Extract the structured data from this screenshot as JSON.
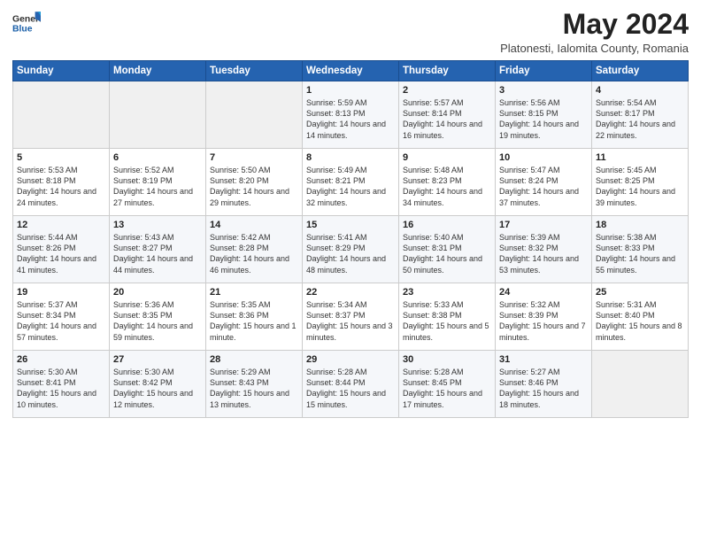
{
  "header": {
    "title": "May 2024",
    "subtitle": "Platonesti, Ialomita County, Romania"
  },
  "days_of_week": [
    "Sunday",
    "Monday",
    "Tuesday",
    "Wednesday",
    "Thursday",
    "Friday",
    "Saturday"
  ],
  "weeks": [
    [
      {
        "day": "",
        "info": ""
      },
      {
        "day": "",
        "info": ""
      },
      {
        "day": "",
        "info": ""
      },
      {
        "day": "1",
        "info": "Sunrise: 5:59 AM\nSunset: 8:13 PM\nDaylight: 14 hours\nand 14 minutes."
      },
      {
        "day": "2",
        "info": "Sunrise: 5:57 AM\nSunset: 8:14 PM\nDaylight: 14 hours\nand 16 minutes."
      },
      {
        "day": "3",
        "info": "Sunrise: 5:56 AM\nSunset: 8:15 PM\nDaylight: 14 hours\nand 19 minutes."
      },
      {
        "day": "4",
        "info": "Sunrise: 5:54 AM\nSunset: 8:17 PM\nDaylight: 14 hours\nand 22 minutes."
      }
    ],
    [
      {
        "day": "5",
        "info": "Sunrise: 5:53 AM\nSunset: 8:18 PM\nDaylight: 14 hours\nand 24 minutes."
      },
      {
        "day": "6",
        "info": "Sunrise: 5:52 AM\nSunset: 8:19 PM\nDaylight: 14 hours\nand 27 minutes."
      },
      {
        "day": "7",
        "info": "Sunrise: 5:50 AM\nSunset: 8:20 PM\nDaylight: 14 hours\nand 29 minutes."
      },
      {
        "day": "8",
        "info": "Sunrise: 5:49 AM\nSunset: 8:21 PM\nDaylight: 14 hours\nand 32 minutes."
      },
      {
        "day": "9",
        "info": "Sunrise: 5:48 AM\nSunset: 8:23 PM\nDaylight: 14 hours\nand 34 minutes."
      },
      {
        "day": "10",
        "info": "Sunrise: 5:47 AM\nSunset: 8:24 PM\nDaylight: 14 hours\nand 37 minutes."
      },
      {
        "day": "11",
        "info": "Sunrise: 5:45 AM\nSunset: 8:25 PM\nDaylight: 14 hours\nand 39 minutes."
      }
    ],
    [
      {
        "day": "12",
        "info": "Sunrise: 5:44 AM\nSunset: 8:26 PM\nDaylight: 14 hours\nand 41 minutes."
      },
      {
        "day": "13",
        "info": "Sunrise: 5:43 AM\nSunset: 8:27 PM\nDaylight: 14 hours\nand 44 minutes."
      },
      {
        "day": "14",
        "info": "Sunrise: 5:42 AM\nSunset: 8:28 PM\nDaylight: 14 hours\nand 46 minutes."
      },
      {
        "day": "15",
        "info": "Sunrise: 5:41 AM\nSunset: 8:29 PM\nDaylight: 14 hours\nand 48 minutes."
      },
      {
        "day": "16",
        "info": "Sunrise: 5:40 AM\nSunset: 8:31 PM\nDaylight: 14 hours\nand 50 minutes."
      },
      {
        "day": "17",
        "info": "Sunrise: 5:39 AM\nSunset: 8:32 PM\nDaylight: 14 hours\nand 53 minutes."
      },
      {
        "day": "18",
        "info": "Sunrise: 5:38 AM\nSunset: 8:33 PM\nDaylight: 14 hours\nand 55 minutes."
      }
    ],
    [
      {
        "day": "19",
        "info": "Sunrise: 5:37 AM\nSunset: 8:34 PM\nDaylight: 14 hours\nand 57 minutes."
      },
      {
        "day": "20",
        "info": "Sunrise: 5:36 AM\nSunset: 8:35 PM\nDaylight: 14 hours\nand 59 minutes."
      },
      {
        "day": "21",
        "info": "Sunrise: 5:35 AM\nSunset: 8:36 PM\nDaylight: 15 hours\nand 1 minute."
      },
      {
        "day": "22",
        "info": "Sunrise: 5:34 AM\nSunset: 8:37 PM\nDaylight: 15 hours\nand 3 minutes."
      },
      {
        "day": "23",
        "info": "Sunrise: 5:33 AM\nSunset: 8:38 PM\nDaylight: 15 hours\nand 5 minutes."
      },
      {
        "day": "24",
        "info": "Sunrise: 5:32 AM\nSunset: 8:39 PM\nDaylight: 15 hours\nand 7 minutes."
      },
      {
        "day": "25",
        "info": "Sunrise: 5:31 AM\nSunset: 8:40 PM\nDaylight: 15 hours\nand 8 minutes."
      }
    ],
    [
      {
        "day": "26",
        "info": "Sunrise: 5:30 AM\nSunset: 8:41 PM\nDaylight: 15 hours\nand 10 minutes."
      },
      {
        "day": "27",
        "info": "Sunrise: 5:30 AM\nSunset: 8:42 PM\nDaylight: 15 hours\nand 12 minutes."
      },
      {
        "day": "28",
        "info": "Sunrise: 5:29 AM\nSunset: 8:43 PM\nDaylight: 15 hours\nand 13 minutes."
      },
      {
        "day": "29",
        "info": "Sunrise: 5:28 AM\nSunset: 8:44 PM\nDaylight: 15 hours\nand 15 minutes."
      },
      {
        "day": "30",
        "info": "Sunrise: 5:28 AM\nSunset: 8:45 PM\nDaylight: 15 hours\nand 17 minutes."
      },
      {
        "day": "31",
        "info": "Sunrise: 5:27 AM\nSunset: 8:46 PM\nDaylight: 15 hours\nand 18 minutes."
      },
      {
        "day": "",
        "info": ""
      }
    ]
  ]
}
